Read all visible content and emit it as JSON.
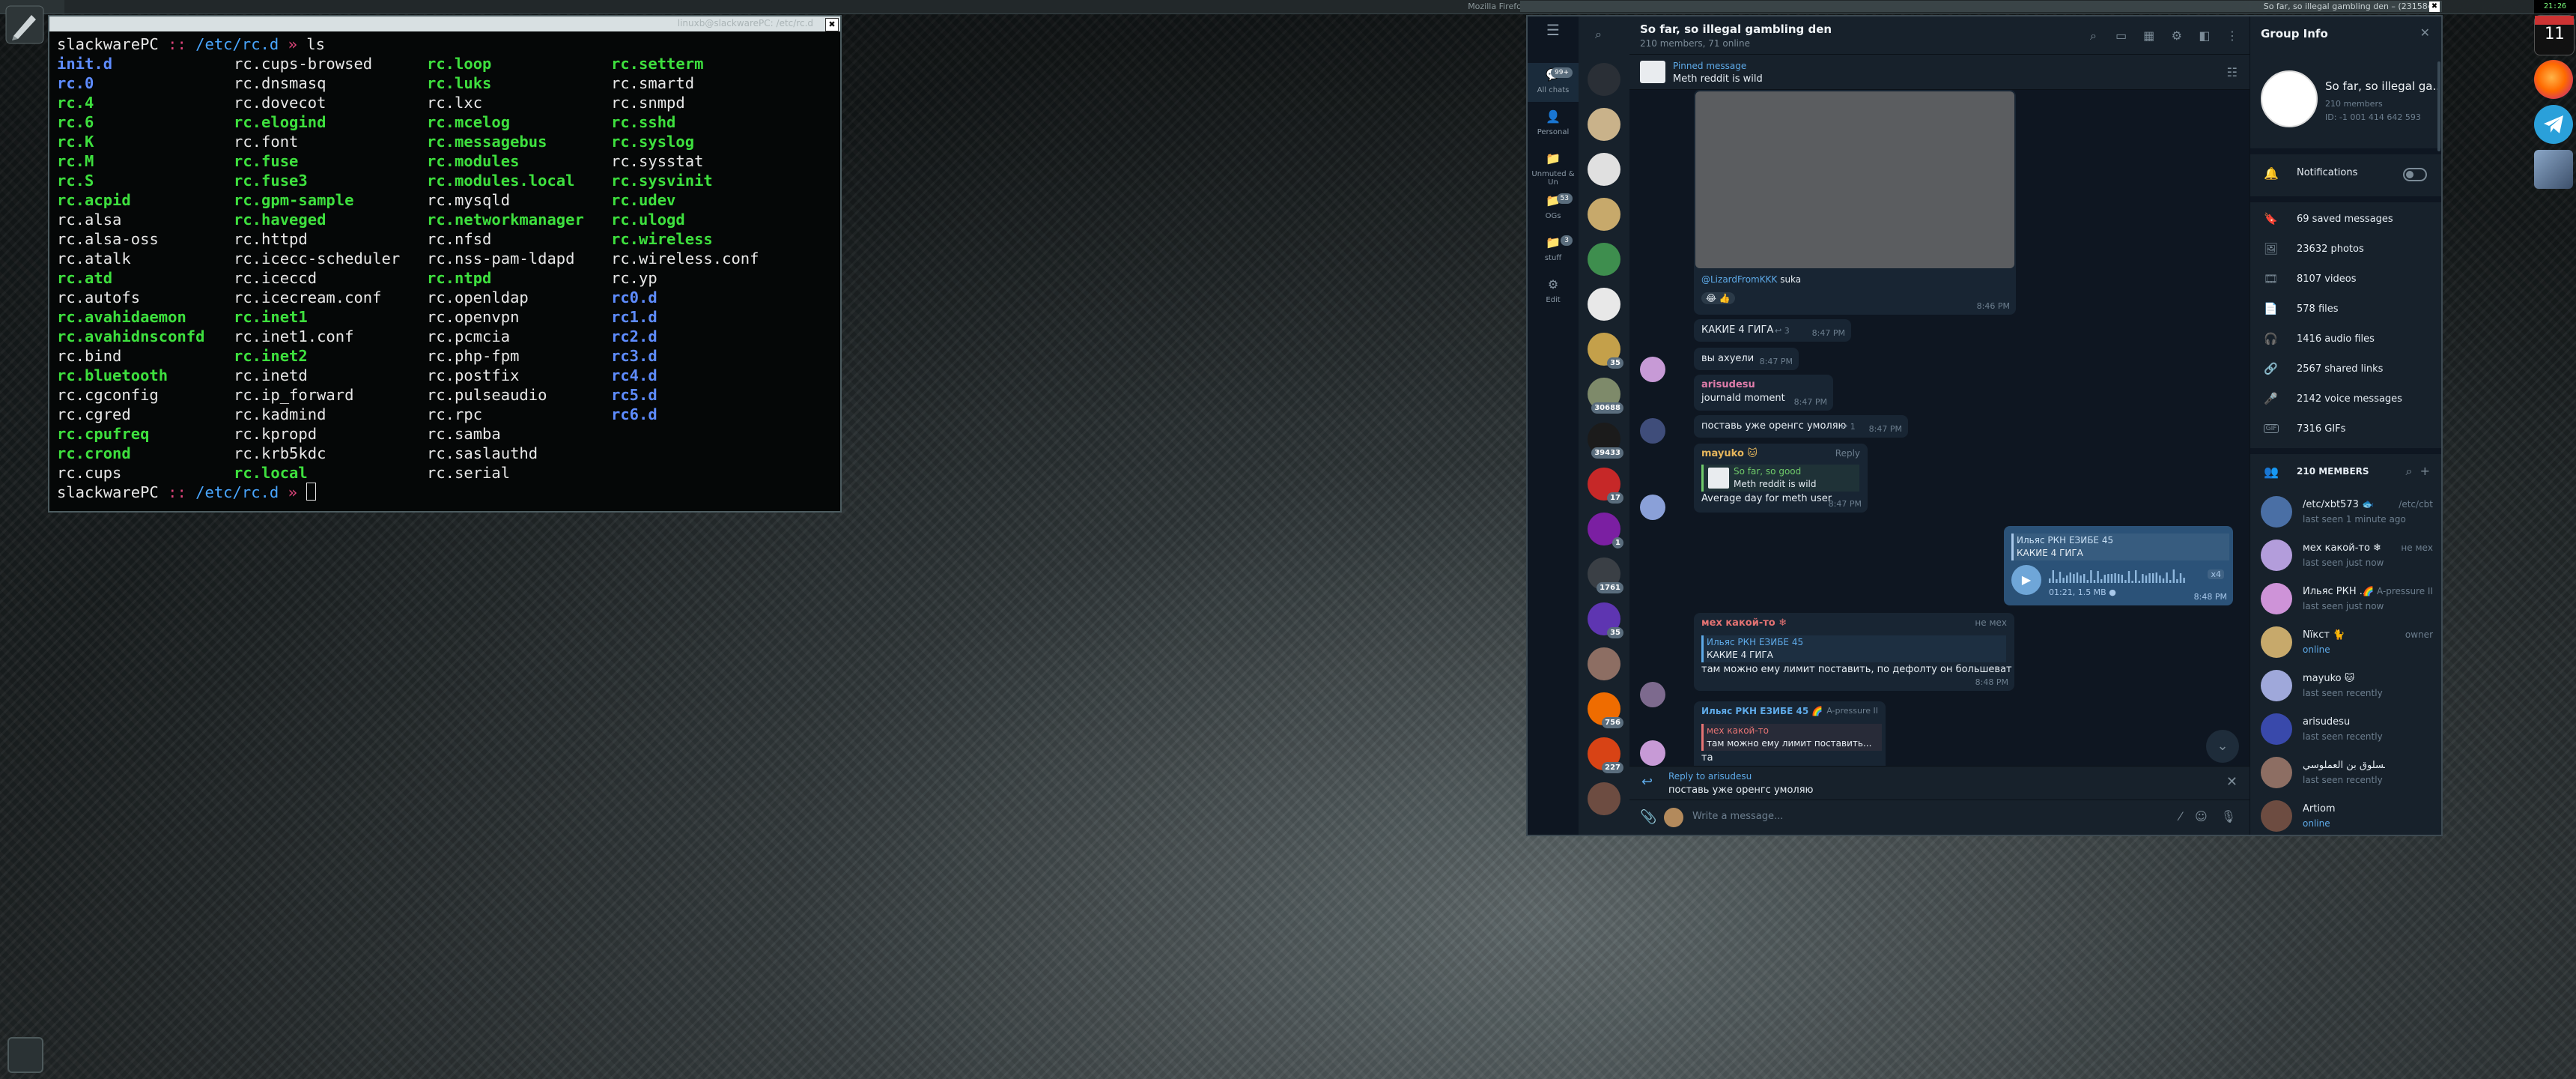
{
  "colors": {
    "terminal_exec": "#3ee03e",
    "terminal_dir": "#5e8cff",
    "prompt_accent": "#e0457b",
    "telegram_bg": "#0e1621",
    "telegram_panel": "#17212b",
    "telegram_accent": "#5eaae8"
  },
  "panel": {
    "task_left": "Mozilla Firefox",
    "task_right": "So far, so illegal gambling den – (231584)",
    "close_glyph": "✖",
    "clock": "21:26"
  },
  "dock": {
    "calendar_day": "11",
    "items": [
      "calendar-icon",
      "firefox-icon",
      "telegram-icon",
      "cube-icon"
    ]
  },
  "terminal": {
    "title": "linuxb@slackwarePC: /etc/rc.d",
    "close_glyph": "✖",
    "prompt_host": "slackwarePC",
    "prompt_sep": " :: ",
    "prompt_path": "/etc/rc.d",
    "prompt_arrow": " » ",
    "command": "ls",
    "files": [
      {
        "name": "init.d",
        "kind": "dir"
      },
      {
        "name": "rc.cups-browsed",
        "kind": "plain"
      },
      {
        "name": "rc.loop",
        "kind": "exec"
      },
      {
        "name": "rc.setterm",
        "kind": "exec"
      },
      {
        "name": "rc.0",
        "kind": "dir"
      },
      {
        "name": "rc.dnsmasq",
        "kind": "plain"
      },
      {
        "name": "rc.luks",
        "kind": "exec"
      },
      {
        "name": "rc.smartd",
        "kind": "plain"
      },
      {
        "name": "rc.4",
        "kind": "exec"
      },
      {
        "name": "rc.dovecot",
        "kind": "plain"
      },
      {
        "name": "rc.lxc",
        "kind": "plain"
      },
      {
        "name": "rc.snmpd",
        "kind": "plain"
      },
      {
        "name": "rc.6",
        "kind": "exec"
      },
      {
        "name": "rc.elogind",
        "kind": "exec"
      },
      {
        "name": "rc.mcelog",
        "kind": "exec"
      },
      {
        "name": "rc.sshd",
        "kind": "exec"
      },
      {
        "name": "rc.K",
        "kind": "exec"
      },
      {
        "name": "rc.font",
        "kind": "plain"
      },
      {
        "name": "rc.messagebus",
        "kind": "exec"
      },
      {
        "name": "rc.syslog",
        "kind": "exec"
      },
      {
        "name": "rc.M",
        "kind": "exec"
      },
      {
        "name": "rc.fuse",
        "kind": "exec"
      },
      {
        "name": "rc.modules",
        "kind": "exec"
      },
      {
        "name": "rc.sysstat",
        "kind": "plain"
      },
      {
        "name": "rc.S",
        "kind": "exec"
      },
      {
        "name": "rc.fuse3",
        "kind": "exec"
      },
      {
        "name": "rc.modules.local",
        "kind": "exec"
      },
      {
        "name": "rc.sysvinit",
        "kind": "exec"
      },
      {
        "name": "rc.acpid",
        "kind": "exec"
      },
      {
        "name": "rc.gpm-sample",
        "kind": "exec"
      },
      {
        "name": "rc.mysqld",
        "kind": "plain"
      },
      {
        "name": "rc.udev",
        "kind": "exec"
      },
      {
        "name": "rc.alsa",
        "kind": "plain"
      },
      {
        "name": "rc.haveged",
        "kind": "exec"
      },
      {
        "name": "rc.networkmanager",
        "kind": "exec"
      },
      {
        "name": "rc.ulogd",
        "kind": "exec"
      },
      {
        "name": "rc.alsa-oss",
        "kind": "plain"
      },
      {
        "name": "rc.httpd",
        "kind": "plain"
      },
      {
        "name": "rc.nfsd",
        "kind": "plain"
      },
      {
        "name": "rc.wireless",
        "kind": "exec"
      },
      {
        "name": "rc.atalk",
        "kind": "plain"
      },
      {
        "name": "rc.icecc-scheduler",
        "kind": "plain"
      },
      {
        "name": "rc.nss-pam-ldapd",
        "kind": "plain"
      },
      {
        "name": "rc.wireless.conf",
        "kind": "plain"
      },
      {
        "name": "rc.atd",
        "kind": "exec"
      },
      {
        "name": "rc.iceccd",
        "kind": "plain"
      },
      {
        "name": "rc.ntpd",
        "kind": "exec"
      },
      {
        "name": "rc.yp",
        "kind": "plain"
      },
      {
        "name": "rc.autofs",
        "kind": "plain"
      },
      {
        "name": "rc.icecream.conf",
        "kind": "plain"
      },
      {
        "name": "rc.openldap",
        "kind": "plain"
      },
      {
        "name": "rc0.d",
        "kind": "dir"
      },
      {
        "name": "rc.avahidaemon",
        "kind": "exec"
      },
      {
        "name": "rc.inet1",
        "kind": "exec"
      },
      {
        "name": "rc.openvpn",
        "kind": "plain"
      },
      {
        "name": "rc1.d",
        "kind": "dir"
      },
      {
        "name": "rc.avahidnsconfd",
        "kind": "exec"
      },
      {
        "name": "rc.inet1.conf",
        "kind": "plain"
      },
      {
        "name": "rc.pcmcia",
        "kind": "plain"
      },
      {
        "name": "rc2.d",
        "kind": "dir"
      },
      {
        "name": "rc.bind",
        "kind": "plain"
      },
      {
        "name": "rc.inet2",
        "kind": "exec"
      },
      {
        "name": "rc.php-fpm",
        "kind": "plain"
      },
      {
        "name": "rc3.d",
        "kind": "dir"
      },
      {
        "name": "rc.bluetooth",
        "kind": "exec"
      },
      {
        "name": "rc.inetd",
        "kind": "plain"
      },
      {
        "name": "rc.postfix",
        "kind": "plain"
      },
      {
        "name": "rc4.d",
        "kind": "dir"
      },
      {
        "name": "rc.cgconfig",
        "kind": "plain"
      },
      {
        "name": "rc.ip_forward",
        "kind": "plain"
      },
      {
        "name": "rc.pulseaudio",
        "kind": "plain"
      },
      {
        "name": "rc5.d",
        "kind": "dir"
      },
      {
        "name": "rc.cgred",
        "kind": "plain"
      },
      {
        "name": "rc.kadmind",
        "kind": "plain"
      },
      {
        "name": "rc.rpc",
        "kind": "plain"
      },
      {
        "name": "rc6.d",
        "kind": "dir"
      },
      {
        "name": "rc.cpufreq",
        "kind": "exec"
      },
      {
        "name": "rc.kpropd",
        "kind": "plain"
      },
      {
        "name": "rc.samba",
        "kind": "plain"
      },
      {
        "name": "",
        "kind": "plain"
      },
      {
        "name": "rc.crond",
        "kind": "exec"
      },
      {
        "name": "rc.krb5kdc",
        "kind": "plain"
      },
      {
        "name": "rc.saslauthd",
        "kind": "plain"
      },
      {
        "name": "",
        "kind": "plain"
      },
      {
        "name": "rc.cups",
        "kind": "plain"
      },
      {
        "name": "rc.local",
        "kind": "exec"
      },
      {
        "name": "rc.serial",
        "kind": "plain"
      },
      {
        "name": "",
        "kind": "plain"
      }
    ]
  },
  "telegram": {
    "rail": [
      {
        "label": "All chats",
        "badge": "99+",
        "icon": "chats-icon"
      },
      {
        "label": "Personal",
        "badge": "",
        "icon": "person-icon"
      },
      {
        "label": "Unmuted & Un",
        "badge": "",
        "icon": "folder-icon"
      },
      {
        "label": "OGs",
        "badge": "53",
        "icon": "folder-icon"
      },
      {
        "label": "stuff",
        "badge": "3",
        "icon": "folder-icon"
      },
      {
        "label": "Edit",
        "badge": "",
        "icon": "sliders-icon"
      }
    ],
    "chat_list_badges": [
      "",
      "",
      "",
      "",
      "",
      "",
      "35",
      "30688",
      "39433",
      "17",
      "1",
      "1761",
      "35",
      "",
      "756",
      "227",
      ""
    ],
    "header": {
      "title": "So far, so illegal gambling den",
      "subtitle": "210 members, 71 online"
    },
    "pinned": {
      "label": "Pinned message",
      "text": "Meth reddit is wild"
    },
    "messages": {
      "m1_caption_author": "@LizardFromKKK",
      "m1_caption_text": "suka",
      "m1_reactions": "😂 👍",
      "m1_time": "8:46 PM",
      "m2_text": "КАКИЕ 4 ГИГА",
      "m2_replies": "↩ 3",
      "m2_time": "8:47 PM",
      "m3_text": "вы ахуели",
      "m3_time": "8:47 PM",
      "m4_name": "arisudesu",
      "m4_text": "journald moment",
      "m4_time": "8:47 PM",
      "m5_text": "поставь уже оренгс умоляю",
      "m5_replies": "↩ 1",
      "m5_time": "8:47 PM",
      "m6_name": "mayuko 🐱",
      "m6_reply_label": "Reply",
      "m6_quote_name": "So far, so good",
      "m6_quote_text": "Meth reddit is wild",
      "m6_text": "Average day for meth user",
      "m6_time": "8:47 PM",
      "m7_quote_name": "Ильяс РКН ЕЗИБЕ 45",
      "m7_quote_text": "КАКИЕ 4 ГИГА",
      "m7_voice_meta": "01:21, 1.5 MB ●",
      "m7_speed": "x4",
      "m7_time": "8:48 PM",
      "m8_name": "мех какой-то ❄",
      "m8_role": "не мех",
      "m8_quote_name": "Ильяс РКН ЕЗИБЕ 45",
      "m8_quote_text": "КАКИЕ 4 ГИГА",
      "m8_text": "там можно ему лимит поставить, по дефолту он большеват",
      "m8_time": "8:48 PM",
      "m9_name": "Ильяс РКН ЕЗИБЕ 45 🌈",
      "m9_role": "A-pressure II",
      "m9_quote_name": "мех какой-то",
      "m9_quote_text": "там можно ему лимит поставить...",
      "m9_text": "та"
    },
    "reply_bar": {
      "title": "Reply to arisudesu",
      "text": "поставь уже оренгс умоляю"
    },
    "composer": {
      "placeholder": "Write a message..."
    },
    "info": {
      "header": "Group Info",
      "name": "So far, so illegal ga...",
      "members": "210 members",
      "id": "ID: -1 001 414 642 593",
      "notifications": "Notifications",
      "stats": [
        {
          "icon": "🔖",
          "label": "69 saved messages"
        },
        {
          "icon": "🖼",
          "label": "23632 photos"
        },
        {
          "icon": "🎞",
          "label": "8107 videos"
        },
        {
          "icon": "📄",
          "label": "578 files"
        },
        {
          "icon": "🎧",
          "label": "1416 audio files"
        },
        {
          "icon": "🔗",
          "label": "2567 shared links"
        },
        {
          "icon": "🎤",
          "label": "2142 voice messages"
        },
        {
          "icon": "GIF",
          "label": "7316 GIFs"
        }
      ],
      "members_header": "210 MEMBERS",
      "member_list": [
        {
          "name": "/etc/xbt573 🐟",
          "status": "last seen 1 minute ago",
          "role": "/etc/cbt",
          "online": false
        },
        {
          "name": "мех какой-то ❄",
          "status": "last seen just now",
          "role": "не мех",
          "online": false
        },
        {
          "name": "Ильяс РКН ...",
          "status": "last seen just now",
          "role": "🌈 A-pressure II",
          "online": false
        },
        {
          "name": "Nїкст 🐈",
          "status": "online",
          "role": "owner",
          "online": true
        },
        {
          "name": "mayuko 🐱",
          "status": "last seen recently",
          "role": "",
          "online": false
        },
        {
          "name": "arisudesu",
          "status": "last seen recently",
          "role": "",
          "online": false
        },
        {
          "name": "المسلوق بن العملوسي",
          "status": "last seen recently",
          "role": "",
          "online": false
        },
        {
          "name": "Artiom",
          "status": "online",
          "role": "",
          "online": true
        }
      ]
    }
  }
}
